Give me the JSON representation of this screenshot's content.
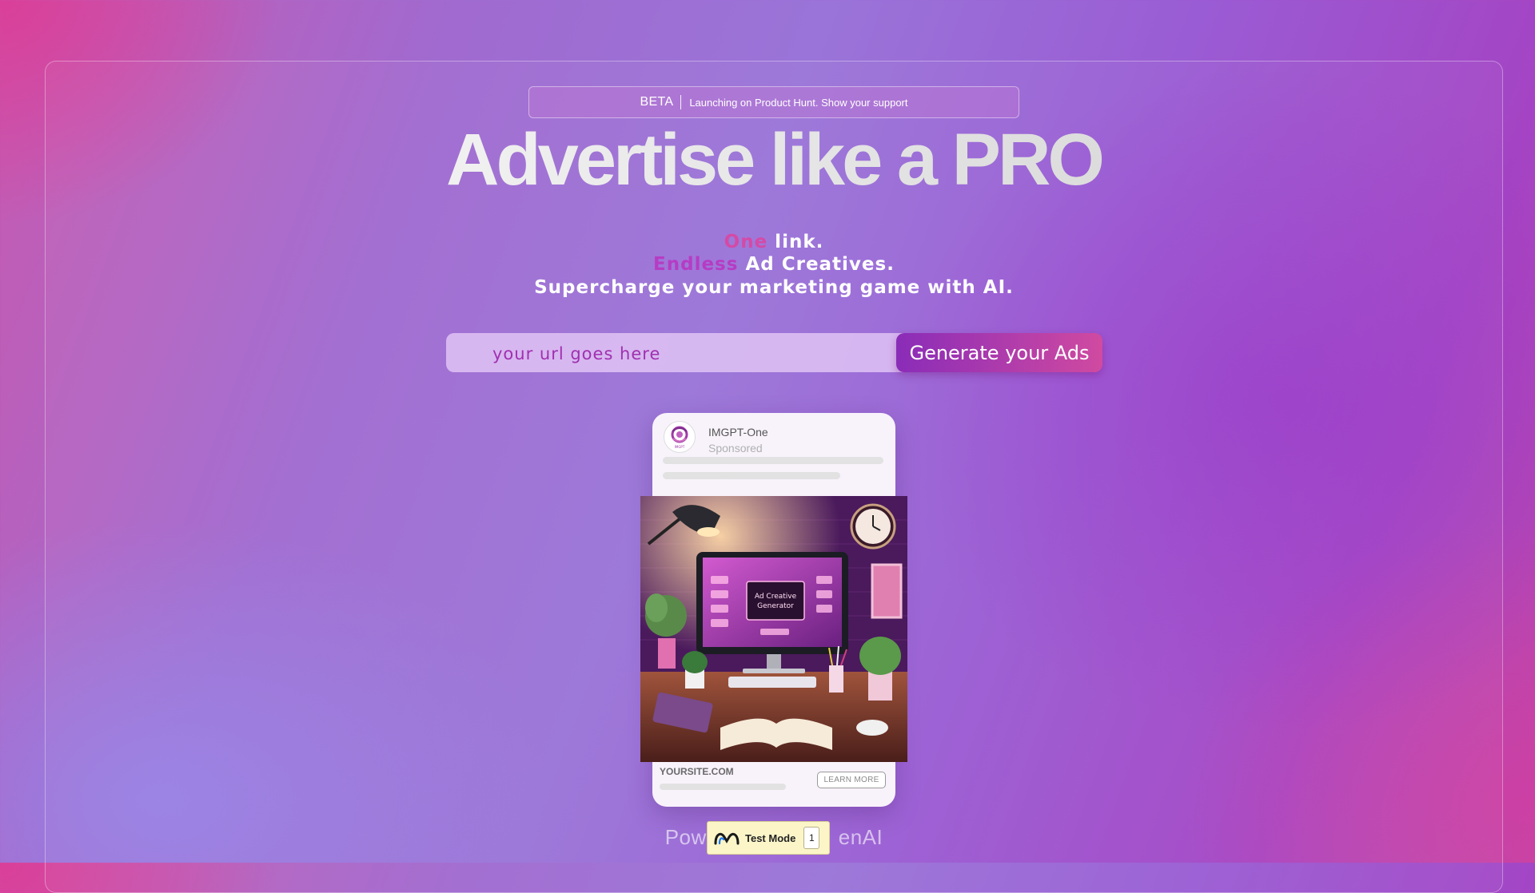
{
  "banner": {
    "tag": "BETA",
    "text": "Launching on Product Hunt. Show your support"
  },
  "hero": {
    "headline": "Advertise like a PRO",
    "line1_accent": "One",
    "line1_rest": " link.",
    "line2_accent": "Endless",
    "line2_rest": " Ad Creatives.",
    "line3": "Supercharge your marketing game with AI."
  },
  "search": {
    "placeholder": "your url goes here",
    "value": "",
    "button_label": "Generate your Ads"
  },
  "ad_preview": {
    "brand_name": "IMGPT-One",
    "sponsored_label": "Sponsored",
    "image_text_line1": "Ad Creative",
    "image_text_line2": "Generator",
    "site_label": "YOURSITE.COM",
    "cta_label": "LEARN MORE"
  },
  "footer": {
    "powered_left": "Powe",
    "powered_right": "enAI"
  },
  "test_mode": {
    "label": "Test Mode",
    "count": "1",
    "icon": "logo-icon"
  },
  "colors": {
    "accent_pink": "#d44aa6",
    "accent_purple": "#b63cc4",
    "button_gradient_start": "#8a2cb8",
    "button_gradient_end": "#d04aa0"
  }
}
